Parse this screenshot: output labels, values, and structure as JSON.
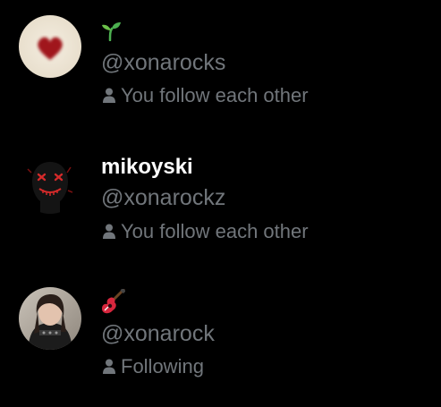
{
  "users": [
    {
      "display_name": "",
      "name_icon": "seedling-icon",
      "handle": "@xonarocks",
      "relationship": "You follow each other",
      "avatar": "heart-avatar"
    },
    {
      "display_name": "mikoyski",
      "name_icon": "",
      "handle": "@xonarockz",
      "relationship": "You follow each other",
      "avatar": "dark-mask-avatar"
    },
    {
      "display_name": "",
      "name_icon": "guitar-icon",
      "handle": "@xonarock",
      "relationship": "Following",
      "avatar": "photo-avatar"
    }
  ],
  "colors": {
    "background": "#000000",
    "name": "#ffffff",
    "secondary": "#71767b",
    "accent_red": "#e0245e"
  }
}
